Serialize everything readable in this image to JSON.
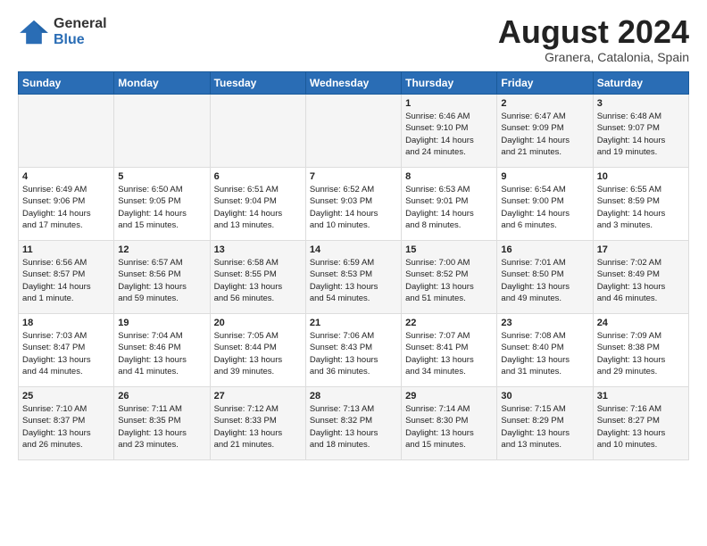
{
  "logo": {
    "general": "General",
    "blue": "Blue"
  },
  "header": {
    "month": "August 2024",
    "location": "Granera, Catalonia, Spain"
  },
  "weekdays": [
    "Sunday",
    "Monday",
    "Tuesday",
    "Wednesday",
    "Thursday",
    "Friday",
    "Saturday"
  ],
  "weeks": [
    [
      {
        "day": "",
        "content": ""
      },
      {
        "day": "",
        "content": ""
      },
      {
        "day": "",
        "content": ""
      },
      {
        "day": "",
        "content": ""
      },
      {
        "day": "1",
        "content": "Sunrise: 6:46 AM\nSunset: 9:10 PM\nDaylight: 14 hours\nand 24 minutes."
      },
      {
        "day": "2",
        "content": "Sunrise: 6:47 AM\nSunset: 9:09 PM\nDaylight: 14 hours\nand 21 minutes."
      },
      {
        "day": "3",
        "content": "Sunrise: 6:48 AM\nSunset: 9:07 PM\nDaylight: 14 hours\nand 19 minutes."
      }
    ],
    [
      {
        "day": "4",
        "content": "Sunrise: 6:49 AM\nSunset: 9:06 PM\nDaylight: 14 hours\nand 17 minutes."
      },
      {
        "day": "5",
        "content": "Sunrise: 6:50 AM\nSunset: 9:05 PM\nDaylight: 14 hours\nand 15 minutes."
      },
      {
        "day": "6",
        "content": "Sunrise: 6:51 AM\nSunset: 9:04 PM\nDaylight: 14 hours\nand 13 minutes."
      },
      {
        "day": "7",
        "content": "Sunrise: 6:52 AM\nSunset: 9:03 PM\nDaylight: 14 hours\nand 10 minutes."
      },
      {
        "day": "8",
        "content": "Sunrise: 6:53 AM\nSunset: 9:01 PM\nDaylight: 14 hours\nand 8 minutes."
      },
      {
        "day": "9",
        "content": "Sunrise: 6:54 AM\nSunset: 9:00 PM\nDaylight: 14 hours\nand 6 minutes."
      },
      {
        "day": "10",
        "content": "Sunrise: 6:55 AM\nSunset: 8:59 PM\nDaylight: 14 hours\nand 3 minutes."
      }
    ],
    [
      {
        "day": "11",
        "content": "Sunrise: 6:56 AM\nSunset: 8:57 PM\nDaylight: 14 hours\nand 1 minute."
      },
      {
        "day": "12",
        "content": "Sunrise: 6:57 AM\nSunset: 8:56 PM\nDaylight: 13 hours\nand 59 minutes."
      },
      {
        "day": "13",
        "content": "Sunrise: 6:58 AM\nSunset: 8:55 PM\nDaylight: 13 hours\nand 56 minutes."
      },
      {
        "day": "14",
        "content": "Sunrise: 6:59 AM\nSunset: 8:53 PM\nDaylight: 13 hours\nand 54 minutes."
      },
      {
        "day": "15",
        "content": "Sunrise: 7:00 AM\nSunset: 8:52 PM\nDaylight: 13 hours\nand 51 minutes."
      },
      {
        "day": "16",
        "content": "Sunrise: 7:01 AM\nSunset: 8:50 PM\nDaylight: 13 hours\nand 49 minutes."
      },
      {
        "day": "17",
        "content": "Sunrise: 7:02 AM\nSunset: 8:49 PM\nDaylight: 13 hours\nand 46 minutes."
      }
    ],
    [
      {
        "day": "18",
        "content": "Sunrise: 7:03 AM\nSunset: 8:47 PM\nDaylight: 13 hours\nand 44 minutes."
      },
      {
        "day": "19",
        "content": "Sunrise: 7:04 AM\nSunset: 8:46 PM\nDaylight: 13 hours\nand 41 minutes."
      },
      {
        "day": "20",
        "content": "Sunrise: 7:05 AM\nSunset: 8:44 PM\nDaylight: 13 hours\nand 39 minutes."
      },
      {
        "day": "21",
        "content": "Sunrise: 7:06 AM\nSunset: 8:43 PM\nDaylight: 13 hours\nand 36 minutes."
      },
      {
        "day": "22",
        "content": "Sunrise: 7:07 AM\nSunset: 8:41 PM\nDaylight: 13 hours\nand 34 minutes."
      },
      {
        "day": "23",
        "content": "Sunrise: 7:08 AM\nSunset: 8:40 PM\nDaylight: 13 hours\nand 31 minutes."
      },
      {
        "day": "24",
        "content": "Sunrise: 7:09 AM\nSunset: 8:38 PM\nDaylight: 13 hours\nand 29 minutes."
      }
    ],
    [
      {
        "day": "25",
        "content": "Sunrise: 7:10 AM\nSunset: 8:37 PM\nDaylight: 13 hours\nand 26 minutes."
      },
      {
        "day": "26",
        "content": "Sunrise: 7:11 AM\nSunset: 8:35 PM\nDaylight: 13 hours\nand 23 minutes."
      },
      {
        "day": "27",
        "content": "Sunrise: 7:12 AM\nSunset: 8:33 PM\nDaylight: 13 hours\nand 21 minutes."
      },
      {
        "day": "28",
        "content": "Sunrise: 7:13 AM\nSunset: 8:32 PM\nDaylight: 13 hours\nand 18 minutes."
      },
      {
        "day": "29",
        "content": "Sunrise: 7:14 AM\nSunset: 8:30 PM\nDaylight: 13 hours\nand 15 minutes."
      },
      {
        "day": "30",
        "content": "Sunrise: 7:15 AM\nSunset: 8:29 PM\nDaylight: 13 hours\nand 13 minutes."
      },
      {
        "day": "31",
        "content": "Sunrise: 7:16 AM\nSunset: 8:27 PM\nDaylight: 13 hours\nand 10 minutes."
      }
    ]
  ]
}
